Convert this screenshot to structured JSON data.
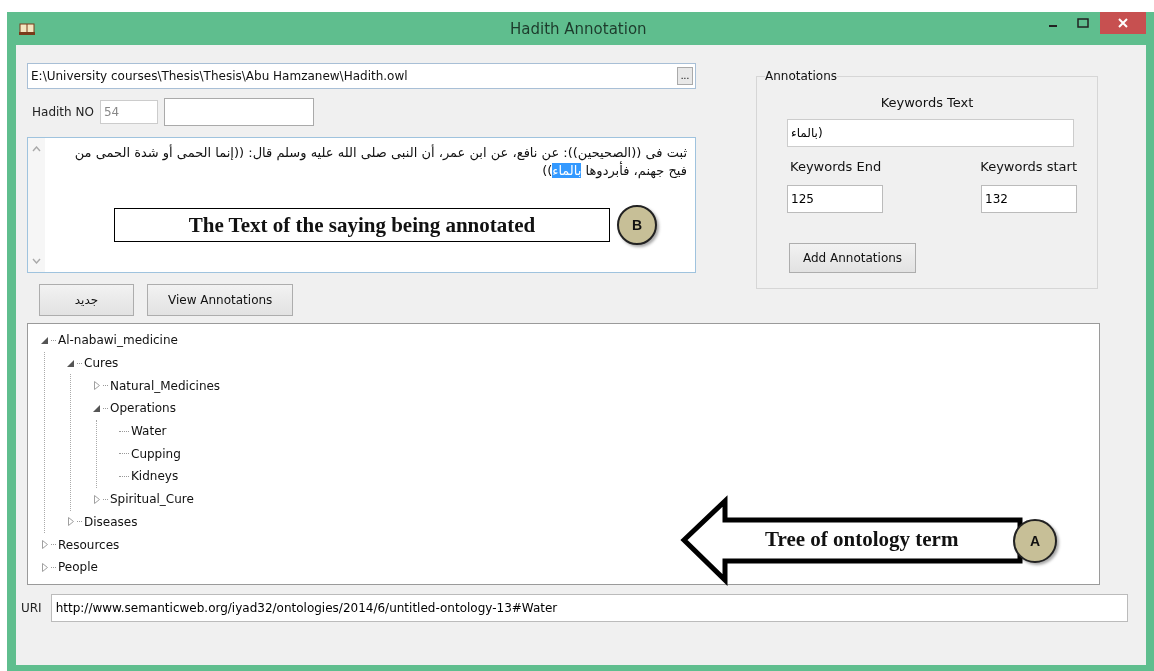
{
  "window": {
    "title": "Hadith Annotation"
  },
  "file_path": {
    "value": "E:\\University courses\\Thesis\\Thesis\\Abu Hamzanew\\Hadith.owl",
    "browse_label": "..."
  },
  "hadith_no": {
    "label": "Hadith NO",
    "value": "54"
  },
  "hadith_text": [
    {
      "text": "ثبت فى ((الصحيحين)): عن نافع، عن ابن عمر، أن النبى صلى الله عليه وسلم قال: ((إنما الحمى أو شدة الحمى من فيح جهنم، فأبردوها ",
      "selected": false
    },
    {
      "text": "بالماء",
      "selected": true
    },
    {
      "text": "))",
      "selected": false
    }
  ],
  "callout_b": {
    "text": "The Text of the saying being annotated",
    "badge": "B"
  },
  "buttons": [
    "جديد",
    "View Annotations"
  ],
  "annotations": {
    "title": "Annotations",
    "keywords_text_label": "Keywords Text",
    "keywords_text": "بالماء)",
    "end_label": "Keywords End",
    "end_value": "125",
    "start_label": "Keywords start",
    "start_value": "132",
    "add_button": "Add Annotations"
  },
  "tree": {
    "items": [
      {
        "label": "Al-nabawi_medicine",
        "kind": "branch",
        "expanded": true,
        "children": [
          {
            "label": "Cures",
            "kind": "branch",
            "expanded": true,
            "children": [
              {
                "label": "Natural_Medicines",
                "kind": "branch",
                "expanded": false
              },
              {
                "label": "Operations",
                "kind": "branch",
                "expanded": true,
                "children": [
                  {
                    "label": "Water",
                    "kind": "leaf"
                  },
                  {
                    "label": "Cupping",
                    "kind": "leaf"
                  },
                  {
                    "label": "Kidneys",
                    "kind": "leaf"
                  }
                ]
              },
              {
                "label": "Spiritual_Cure",
                "kind": "branch",
                "expanded": false
              }
            ]
          },
          {
            "label": "Diseases",
            "kind": "branch",
            "expanded": false
          }
        ]
      },
      {
        "label": "Resources",
        "kind": "branch",
        "expanded": false
      },
      {
        "label": "People",
        "kind": "branch",
        "expanded": false
      }
    ]
  },
  "callout_a": {
    "text": "Tree of ontology term",
    "badge": "A"
  },
  "uri": {
    "label": "URI",
    "value": "http://www.semanticweb.org/iyad32/ontologies/2014/6/untitled-ontology-13#Water"
  }
}
